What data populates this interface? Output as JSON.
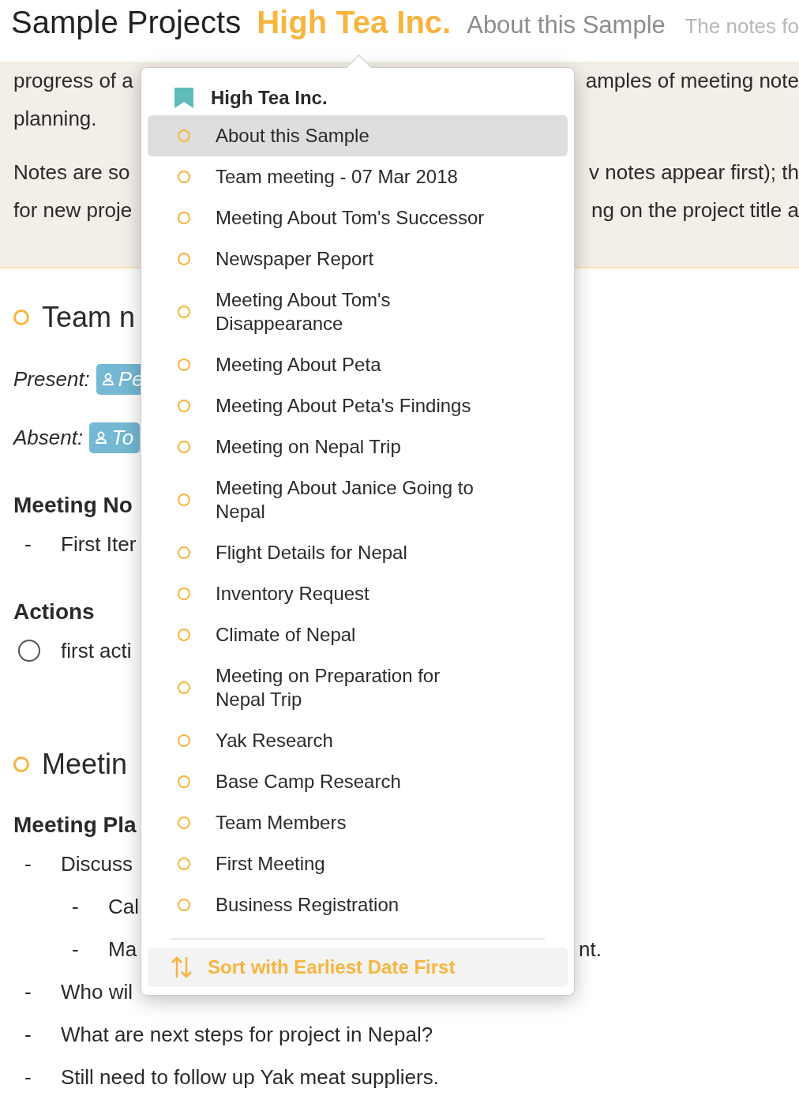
{
  "header": {
    "group": "Sample Projects",
    "project": "High Tea Inc.",
    "note": "About this Sample",
    "faded_tail": "The notes fo"
  },
  "intro_paragraphs": [
    {
      "rows": [
        {
          "left": "progress of a",
          "right": "amples of meeting note"
        },
        {
          "left": "planning."
        }
      ]
    },
    {
      "rows": [
        {
          "left": "Notes are so",
          "right": "v notes appear first); th"
        },
        {
          "left": "for new proje",
          "right": "ng on the project title a"
        }
      ]
    }
  ],
  "content": [
    {
      "kind": "note_title",
      "text": "Team n"
    },
    {
      "kind": "attendees",
      "label": "Present:",
      "tag": "Pe"
    },
    {
      "kind": "attendees",
      "label": "Absent:",
      "tag": "To"
    },
    {
      "kind": "heading",
      "text": "Meeting No"
    },
    {
      "kind": "bullet",
      "marker": "-",
      "text": "First Iter"
    },
    {
      "kind": "heading",
      "text": "Actions"
    },
    {
      "kind": "action",
      "text": "first acti",
      "checked": false
    },
    {
      "kind": "note_title",
      "text": "Meetin"
    },
    {
      "kind": "heading",
      "text": "Meeting Pla"
    },
    {
      "kind": "bullet",
      "marker": "-",
      "text": "Discuss",
      "children": [
        {
          "marker": "-",
          "text": "Cal"
        },
        {
          "marker": "-",
          "text": "Ma",
          "right": "nt."
        }
      ]
    },
    {
      "kind": "bullet",
      "marker": "-",
      "text": "Who wil"
    },
    {
      "kind": "bullet",
      "marker": "-",
      "text": "What are next steps for project in Nepal?"
    },
    {
      "kind": "bullet",
      "marker": "-",
      "text": "Still need to follow up Yak meat suppliers."
    }
  ],
  "popover": {
    "title": "High Tea Inc.",
    "items": [
      {
        "text": "About this Sample",
        "selected": true
      },
      {
        "text": "Team meeting - 07 Mar 2018",
        "selected": false
      },
      {
        "text": "Meeting About Tom's Successor",
        "selected": false
      },
      {
        "text": "Newspaper Report",
        "selected": false
      },
      {
        "text": "Meeting About Tom's Disappearance",
        "selected": false
      },
      {
        "text": "Meeting About Peta",
        "selected": false
      },
      {
        "text": "Meeting About Peta's Findings",
        "selected": false
      },
      {
        "text": "Meeting on Nepal Trip",
        "selected": false
      },
      {
        "text": "Meeting About Janice Going to Nepal",
        "selected": false
      },
      {
        "text": "Flight Details for Nepal",
        "selected": false
      },
      {
        "text": "Inventory Request",
        "selected": false
      },
      {
        "text": "Climate of Nepal",
        "selected": false
      },
      {
        "text": "Meeting on Preparation for Nepal Trip",
        "selected": false
      },
      {
        "text": "Yak Research",
        "selected": false
      },
      {
        "text": "Base Camp Research",
        "selected": false
      },
      {
        "text": "Team Members",
        "selected": false
      },
      {
        "text": "First Meeting",
        "selected": false
      },
      {
        "text": "Business Registration",
        "selected": false
      }
    ],
    "sort_button": "Sort with Earliest Date First"
  }
}
